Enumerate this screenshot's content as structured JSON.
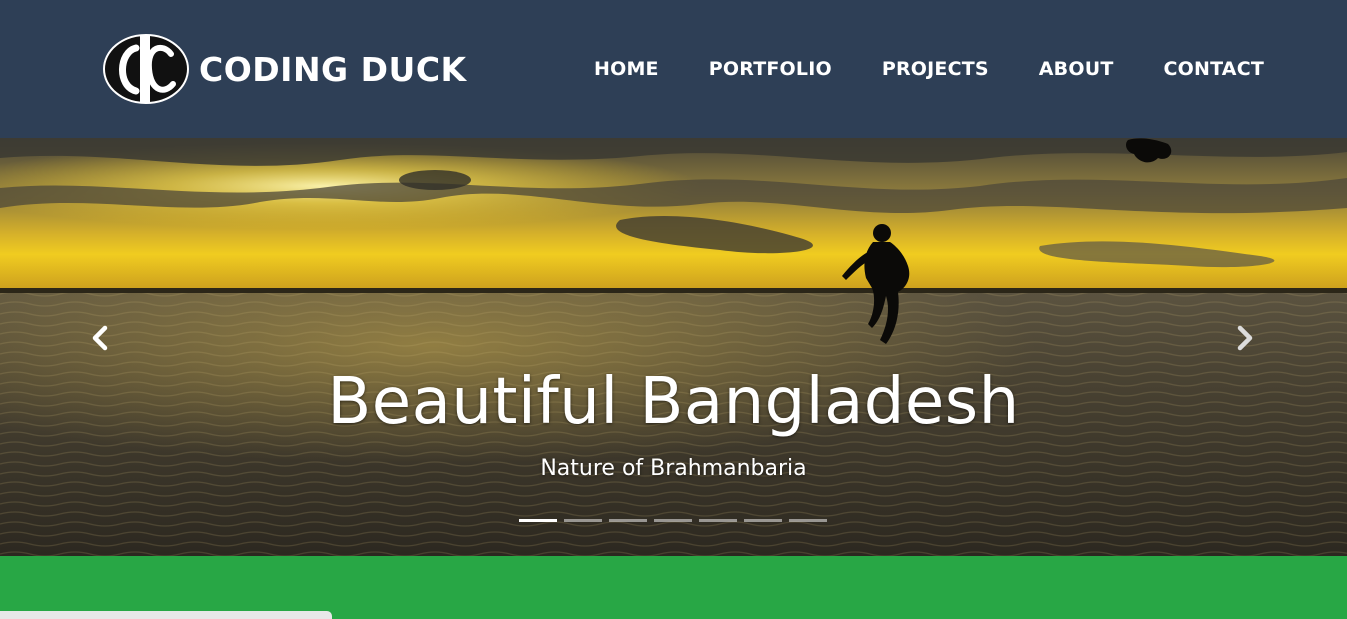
{
  "brand": {
    "name": "CODING DUCK",
    "logo_icon": "cd-logo-icon"
  },
  "nav": {
    "items": [
      {
        "label": "HOME"
      },
      {
        "label": "PORTFOLIO"
      },
      {
        "label": "PROJECTS"
      },
      {
        "label": "ABOUT"
      },
      {
        "label": "CONTACT"
      }
    ]
  },
  "carousel": {
    "title": "Beautiful Bangladesh",
    "subtitle": "Nature of Brahmanbaria",
    "slide_count": 7,
    "active_index": 0,
    "prev_icon": "chevron-left-icon",
    "next_icon": "chevron-right-icon"
  },
  "colors": {
    "navbar": "#2e3f56",
    "accent_band": "#28a745",
    "text": "#ffffff"
  }
}
